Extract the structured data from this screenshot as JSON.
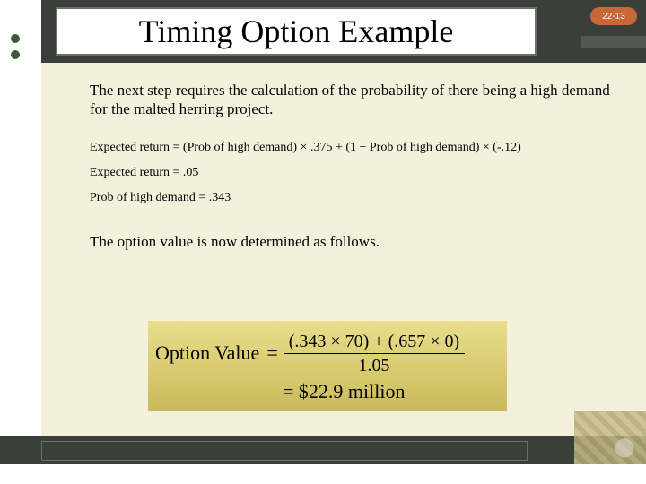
{
  "slide_number": "22-13",
  "title": "Timing Option Example",
  "paragraph1": "The next step requires the calculation of the probability of there being a high demand for the malted herring project.",
  "equations": {
    "line1": "Expected return = (Prob of high demand) × .375 + (1 − Prob of high demand) × (-.12)",
    "line2": "Expected return = .05",
    "line3": "Prob of high demand = .343"
  },
  "paragraph2": "The option value is now determined as follows.",
  "option_value": {
    "label": "Option Value",
    "numerator": "(.343 × 70) + (.657 × 0)",
    "denominator": "1.05",
    "result": "= $22.9 million"
  }
}
